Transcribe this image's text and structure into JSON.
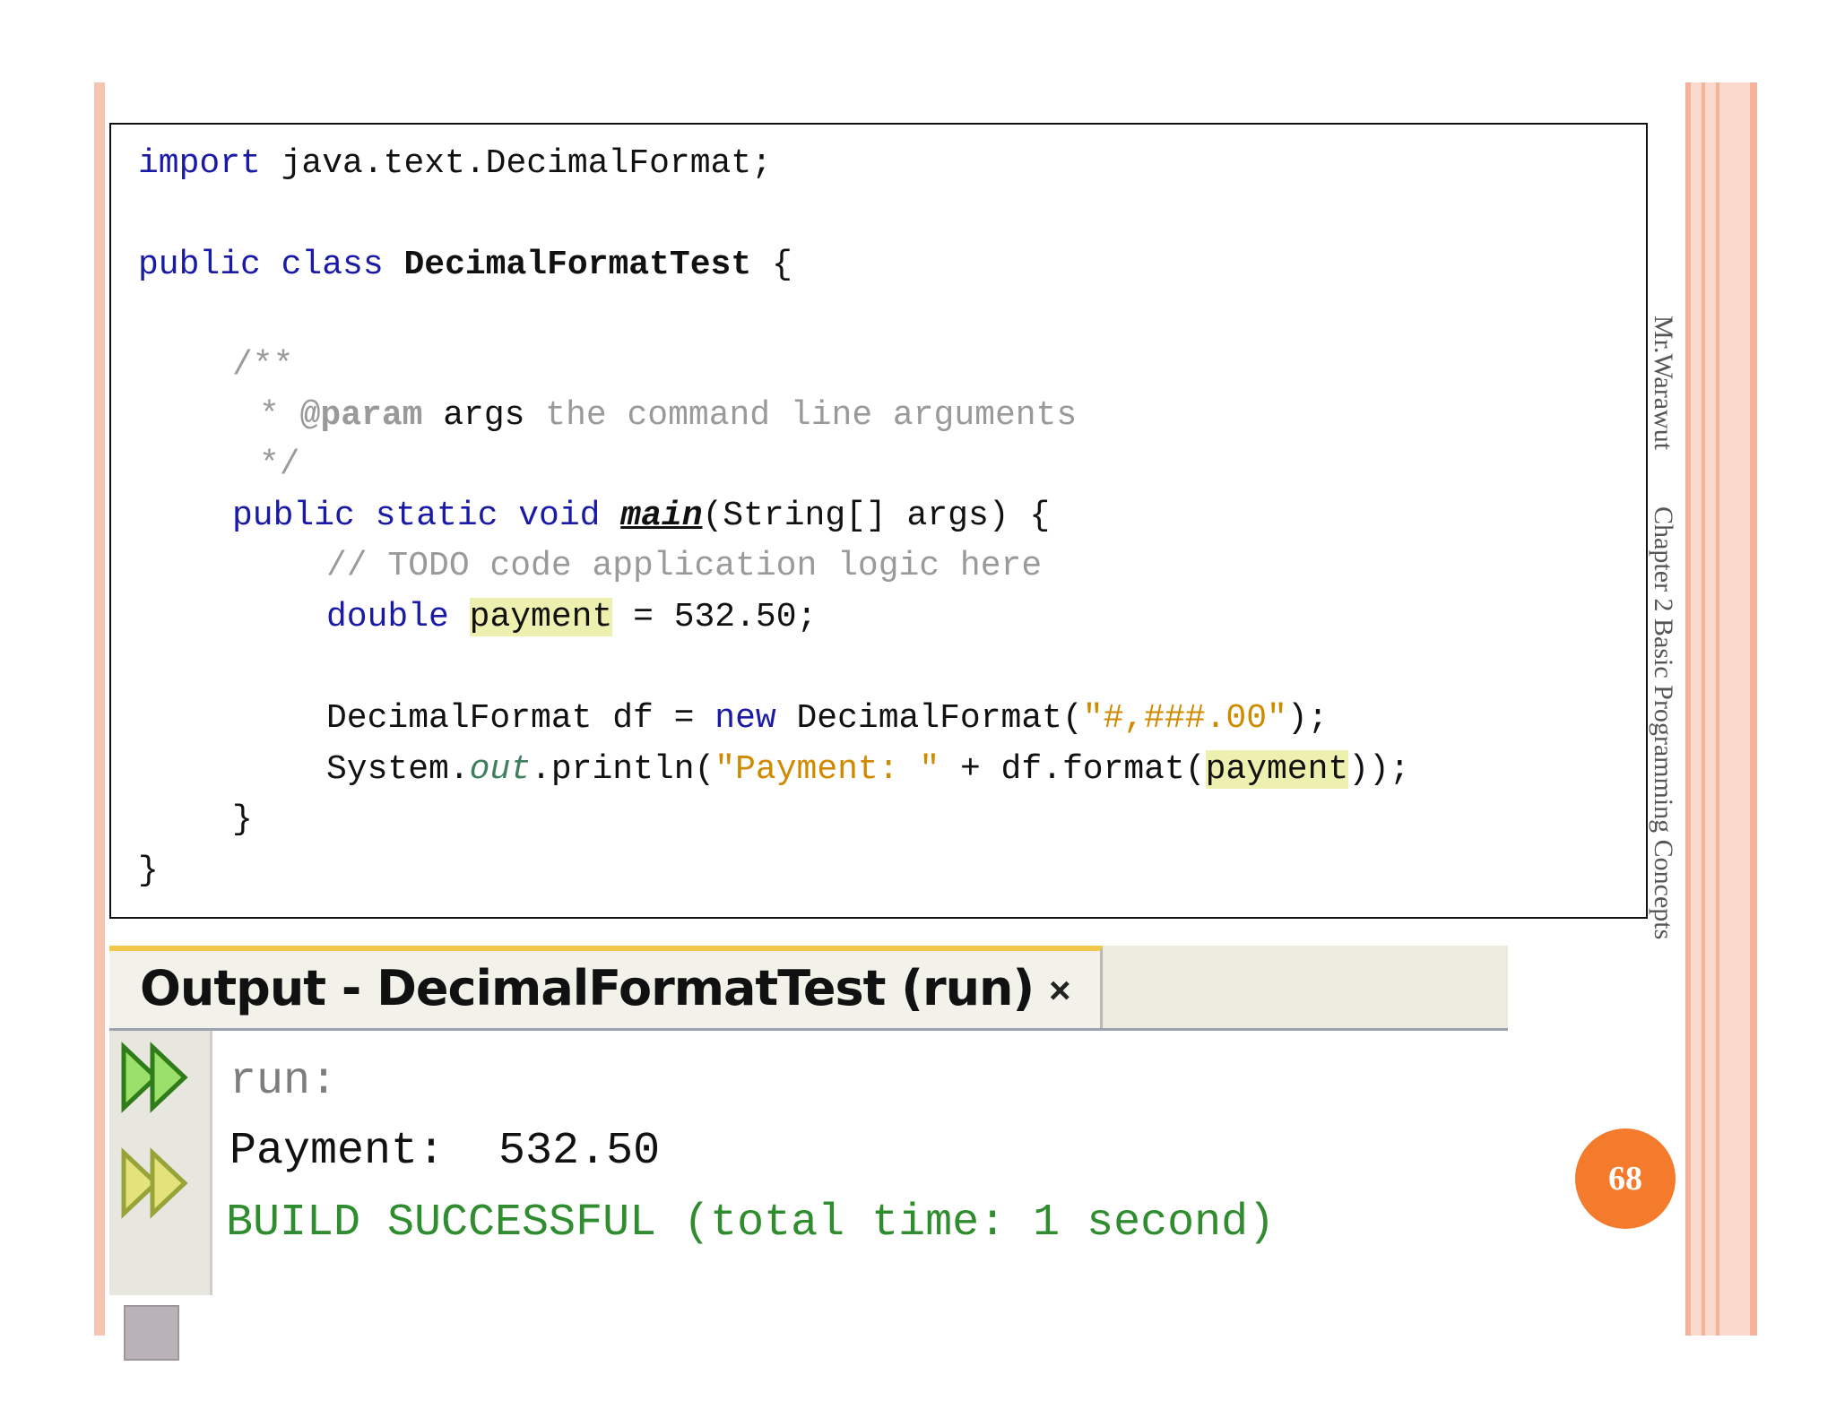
{
  "code": {
    "l1_kw": "import",
    "l1_rest": " java.text.DecimalFormat;",
    "l2_kw": "public class",
    "l2_class": "DecimalFormatTest",
    "l2_brace": " {",
    "l3": "/**",
    "l4_star": "* ",
    "l4_tag": "@param",
    "l4_args": " args",
    "l4_text": " the command line arguments",
    "l5": "*/",
    "l6_kw": "public static void",
    "l6_main": "main",
    "l6_rest": "(String[] args) {",
    "l7": "// TODO code application logic here",
    "l8_kw": "double",
    "l8_var": "payment",
    "l8_rest": " = 532.50;",
    "l9_type": "DecimalFormat df = ",
    "l9_new": "new",
    "l9_ctor": " DecimalFormat(",
    "l9_str": "\"#,###.00\"",
    "l9_end": ");",
    "l10_sys": "System.",
    "l10_out": "out",
    "l10_print": ".println(",
    "l10_str": "\"Payment: \"",
    "l10_plus": " + df.format(",
    "l10_var": "payment",
    "l10_end": "));",
    "l11": "}",
    "l12": "}"
  },
  "output": {
    "title": "Output - DecimalFormatTest (run)",
    "close": "×",
    "lines": [
      "run:",
      "Payment:  532.50",
      "BUILD SUCCESSFUL (total time: 1 second)"
    ]
  },
  "side": {
    "author": "Mr.Warawut",
    "chapter": "Chapter 2 Basic Programming Concepts"
  },
  "page_number": "68",
  "colors": {
    "keyword": "#1a1aa6",
    "comment": "#9a9a9a",
    "string": "#d08a00",
    "build_success": "#2f8c2f",
    "badge": "#f47a2c"
  }
}
